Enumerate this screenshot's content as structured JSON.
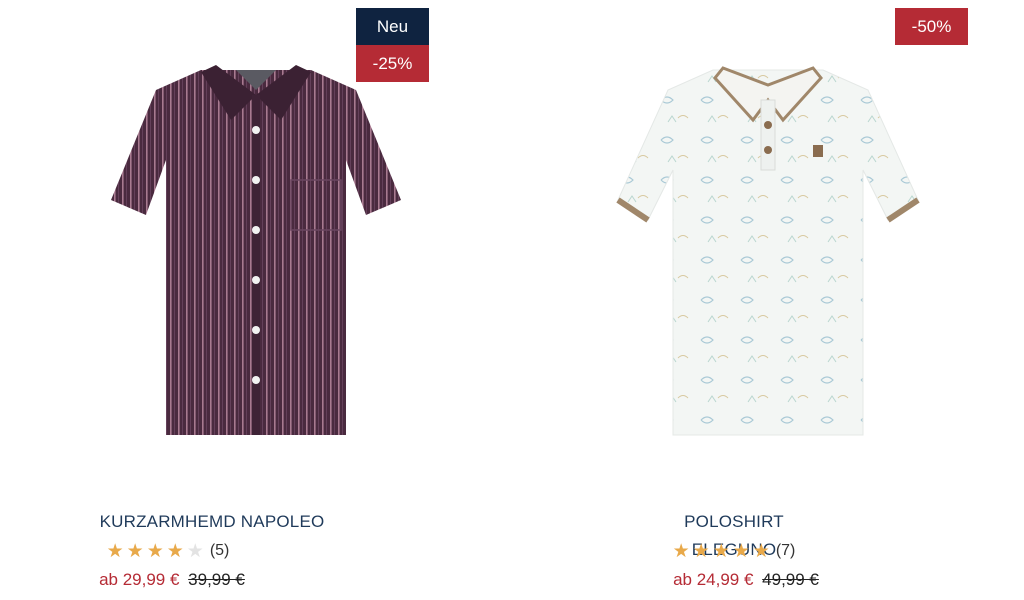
{
  "products": [
    {
      "name": "KURZARMHEMD NAPOLEO",
      "badges": {
        "new": "Neu",
        "discount": "-25%"
      },
      "rating": 4,
      "max_rating": 5,
      "review_count": "(5)",
      "price_from": "ab 29,99 €",
      "price_old": "39,99 €",
      "image_icon": "striped-short-sleeve-shirt",
      "colors": {
        "shirt": "#4a2a3f",
        "stripe": "#9b6a82"
      }
    },
    {
      "name": "POLOSHIRT ELEGUNO",
      "badges": {
        "discount": "-50%"
      },
      "rating": 5,
      "max_rating": 5,
      "review_count": "(7)",
      "price_from": "ab 24,99 €",
      "price_old": "49,99 €",
      "image_icon": "printed-polo-shirt",
      "colors": {
        "shirt": "#f3f6f4",
        "trim": "#a0876a"
      }
    }
  ],
  "colors": {
    "badge_new": "#0f2340",
    "badge_sale": "#b52b35",
    "star_on": "#e8a94a",
    "star_off": "#e3e3e3",
    "price_red": "#b52b35",
    "name_blue": "#1f3a5a"
  }
}
